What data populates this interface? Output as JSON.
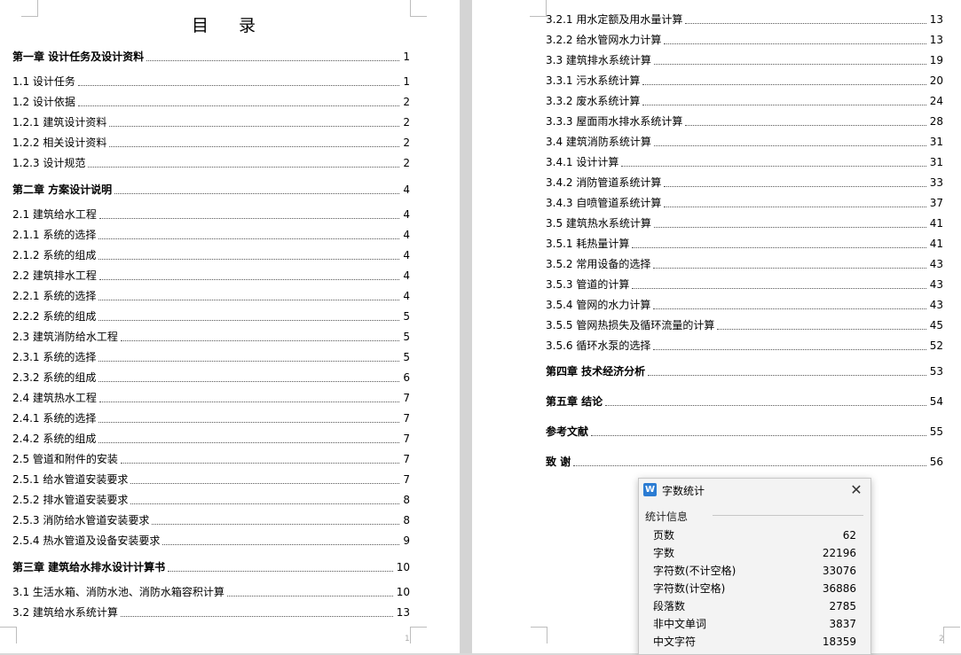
{
  "toc": {
    "title": "目 录",
    "left_page_number": "1",
    "right_page_number": "2",
    "left_entries": [
      {
        "text": "第一章 设计任务及设计资料",
        "page": "1",
        "chapter": true
      },
      {
        "text": "1.1 设计任务",
        "page": "1"
      },
      {
        "text": "1.2 设计依据",
        "page": "2"
      },
      {
        "text": "1.2.1 建筑设计资料",
        "page": "2"
      },
      {
        "text": "1.2.2 相关设计资料",
        "page": "2"
      },
      {
        "text": "1.2.3 设计规范",
        "page": "2"
      },
      {
        "text": "第二章 方案设计说明",
        "page": "4",
        "chapter": true
      },
      {
        "text": "2.1 建筑给水工程",
        "page": "4"
      },
      {
        "text": "2.1.1 系统的选择",
        "page": "4"
      },
      {
        "text": "2.1.2 系统的组成",
        "page": "4"
      },
      {
        "text": "2.2 建筑排水工程",
        "page": "4"
      },
      {
        "text": "2.2.1 系统的选择",
        "page": "4"
      },
      {
        "text": "2.2.2 系统的组成",
        "page": "5"
      },
      {
        "text": "2.3 建筑消防给水工程",
        "page": "5"
      },
      {
        "text": "2.3.1 系统的选择",
        "page": "5"
      },
      {
        "text": "2.3.2 系统的组成",
        "page": "6"
      },
      {
        "text": "2.4 建筑热水工程",
        "page": "7"
      },
      {
        "text": "2.4.1 系统的选择",
        "page": "7"
      },
      {
        "text": "2.4.2 系统的组成",
        "page": "7"
      },
      {
        "text": "2.5 管道和附件的安装",
        "page": "7"
      },
      {
        "text": "2.5.1 给水管道安装要求",
        "page": "7"
      },
      {
        "text": "2.5.2 排水管道安装要求",
        "page": "8"
      },
      {
        "text": "2.5.3 消防给水管道安装要求",
        "page": "8"
      },
      {
        "text": "2.5.4 热水管道及设备安装要求",
        "page": "9"
      },
      {
        "text": "第三章 建筑给水排水设计计算书",
        "page": "10",
        "chapter": true
      },
      {
        "text": "3.1 生活水箱、消防水池、消防水箱容积计算",
        "page": "10"
      },
      {
        "text": "3.2 建筑给水系统计算",
        "page": "13"
      }
    ],
    "right_entries": [
      {
        "text": "3.2.1 用水定额及用水量计算",
        "page": "13"
      },
      {
        "text": "3.2.2 给水管网水力计算",
        "page": "13"
      },
      {
        "text": "3.3 建筑排水系统计算",
        "page": "19"
      },
      {
        "text": "3.3.1 污水系统计算",
        "page": "20"
      },
      {
        "text": "3.3.2 废水系统计算",
        "page": "24"
      },
      {
        "text": "3.3.3 屋面雨水排水系统计算",
        "page": "28"
      },
      {
        "text": "3.4 建筑消防系统计算",
        "page": "31"
      },
      {
        "text": "3.4.1 设计计算",
        "page": "31"
      },
      {
        "text": "3.4.2 消防管道系统计算",
        "page": "33"
      },
      {
        "text": "3.4.3 自喷管道系统计算",
        "page": "37"
      },
      {
        "text": "3.5 建筑热水系统计算",
        "page": "41"
      },
      {
        "text": "3.5.1 耗热量计算",
        "page": "41"
      },
      {
        "text": "3.5.2 常用设备的选择",
        "page": "43"
      },
      {
        "text": "3.5.3 管道的计算",
        "page": "43"
      },
      {
        "text": "3.5.4 管网的水力计算",
        "page": "43"
      },
      {
        "text": "3.5.5 管网热损失及循环流量的计算",
        "page": "45"
      },
      {
        "text": "3.5.6 循环水泵的选择",
        "page": "52"
      },
      {
        "text": "第四章 技术经济分析",
        "page": "53",
        "chapter": true
      },
      {
        "text": "第五章 结论",
        "page": "54",
        "chapter": true
      },
      {
        "text": "参考文献",
        "page": "55",
        "chapter": true
      },
      {
        "text": "致  谢",
        "page": "56",
        "chapter": true
      }
    ]
  },
  "dialog": {
    "title": "字数统计",
    "icon_letter": "W",
    "section": "统计信息",
    "stats": [
      {
        "label": "页数",
        "value": "62"
      },
      {
        "label": "字数",
        "value": "22196"
      },
      {
        "label": "字符数(不计空格)",
        "value": "33076"
      },
      {
        "label": "字符数(计空格)",
        "value": "36886"
      },
      {
        "label": "段落数",
        "value": "2785"
      },
      {
        "label": "非中文单词",
        "value": "3837"
      },
      {
        "label": "中文字符",
        "value": "18359"
      }
    ]
  }
}
